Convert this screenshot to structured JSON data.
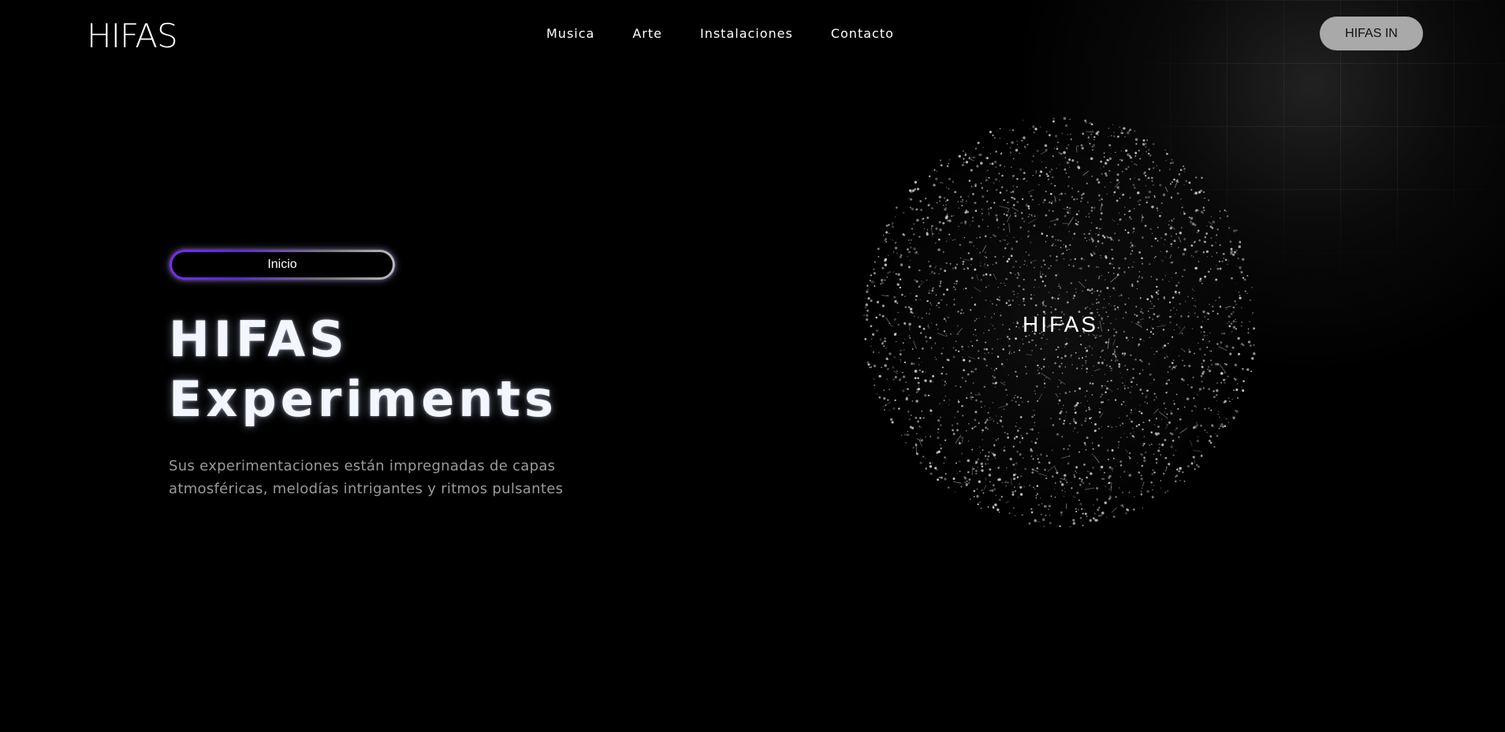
{
  "header": {
    "logo": "HIFAS",
    "nav": [
      {
        "label": "Musica"
      },
      {
        "label": "Arte"
      },
      {
        "label": "Instalaciones"
      },
      {
        "label": "Contacto"
      }
    ],
    "cta_label": "HIFAS IN"
  },
  "hero": {
    "pill_label": "Inicio",
    "title_line1": "HIFAS",
    "title_line2": "Experiments",
    "description": "Sus experimentaciones están impregnadas de capas atmosféricas, melodías intrigantes y ritmos pulsantes"
  },
  "visual": {
    "sphere_label": "HIFAS"
  },
  "colors": {
    "background": "#000000",
    "cta_background": "#a9a9a9",
    "pill_gradient_start": "#7a2cff",
    "pill_gradient_end": "#bbbbbb",
    "description_text": "#9a9a9a"
  }
}
